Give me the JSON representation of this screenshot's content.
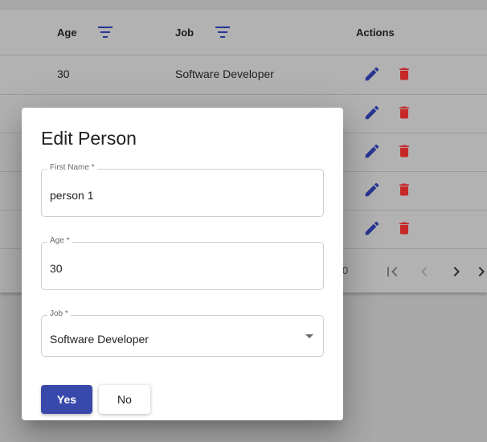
{
  "table": {
    "headers": {
      "age": "Age",
      "job": "Job",
      "actions": "Actions"
    },
    "rows": [
      {
        "age": "30",
        "job": "Software Developer"
      },
      {
        "age": "",
        "job": ""
      },
      {
        "age": "",
        "job": ""
      },
      {
        "age": "",
        "job": ""
      },
      {
        "age": "",
        "job": ""
      }
    ],
    "pager": {
      "range_fragment": "0"
    },
    "icons": {
      "filter": "filter-list-icon",
      "edit": "pencil-icon",
      "delete": "trash-icon",
      "first_page": "first-page-icon",
      "prev_page": "chevron-left-icon",
      "next_page": "chevron-right-icon",
      "last_page": "last-page-icon"
    },
    "colors": {
      "edit": "#283593",
      "delete": "#c62828"
    }
  },
  "dialog": {
    "title": "Edit Person",
    "fields": {
      "first_name": {
        "label": "First Name *",
        "value": "person 1"
      },
      "age": {
        "label": "Age *",
        "value": "30"
      },
      "job": {
        "label": "Job *",
        "value": "Software Developer"
      }
    },
    "buttons": {
      "yes": "Yes",
      "no": "No"
    },
    "colors": {
      "primary": "#3949ab"
    }
  }
}
